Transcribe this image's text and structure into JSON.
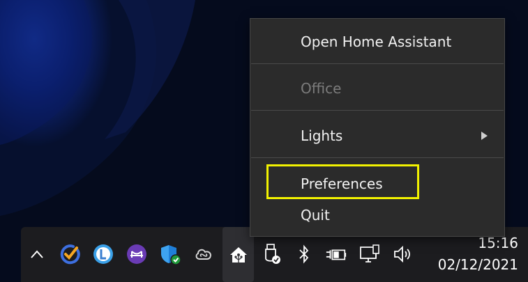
{
  "menu": {
    "items": [
      {
        "label": "Open Home Assistant",
        "enabled": true
      },
      {
        "label": "Office",
        "enabled": false
      },
      {
        "label": "Lights",
        "enabled": true,
        "has_submenu": true
      },
      {
        "label": "Preferences",
        "enabled": true,
        "highlighted": true
      },
      {
        "label": "Quit",
        "enabled": true
      }
    ],
    "highlight_color": "#f2f200"
  },
  "tray": {
    "icons": [
      "chevron-up-icon",
      "todo-check-icon",
      "l-circle-app-icon",
      "bridge-app-icon",
      "security-shield-icon",
      "creative-cloud-icon",
      "home-assistant-icon",
      "usb-eject-icon",
      "bluetooth-icon",
      "power-plug-battery-icon",
      "network-monitor-icon",
      "speaker-volume-icon"
    ]
  },
  "clock": {
    "time": "15:16",
    "date": "02/12/2021"
  },
  "colors": {
    "menu_bg": "#2b2b2b",
    "taskbar_bg": "#1c1c1f",
    "accent_blue": "#2f7bd6"
  }
}
